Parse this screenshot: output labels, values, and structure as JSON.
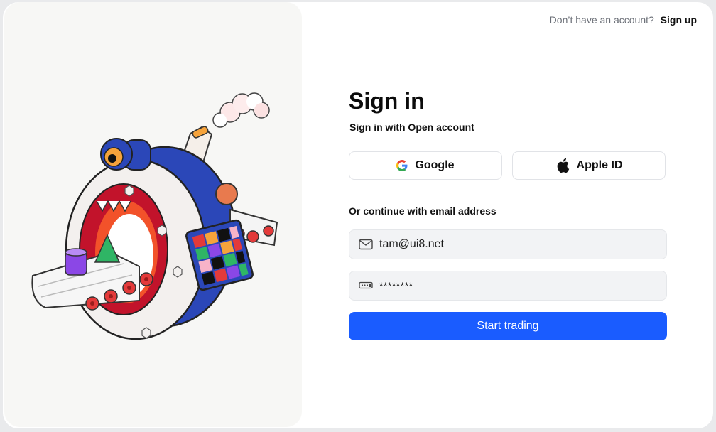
{
  "header": {
    "prompt": "Don’t have an account?",
    "signup_label": "Sign up"
  },
  "form": {
    "title": "Sign in",
    "subtitle": "Sign in with Open account",
    "google_label": "Google",
    "apple_label": "Apple ID",
    "divider_label": "Or continue with email address",
    "email_value": "tam@ui8.net",
    "password_value": "********",
    "submit_label": "Start trading"
  },
  "colors": {
    "accent": "#1a5cff",
    "field_bg": "#f2f3f5",
    "panel_bg": "#f7f7f5"
  },
  "icons": [
    "google-icon",
    "apple-icon",
    "mail-icon",
    "password-icon"
  ]
}
